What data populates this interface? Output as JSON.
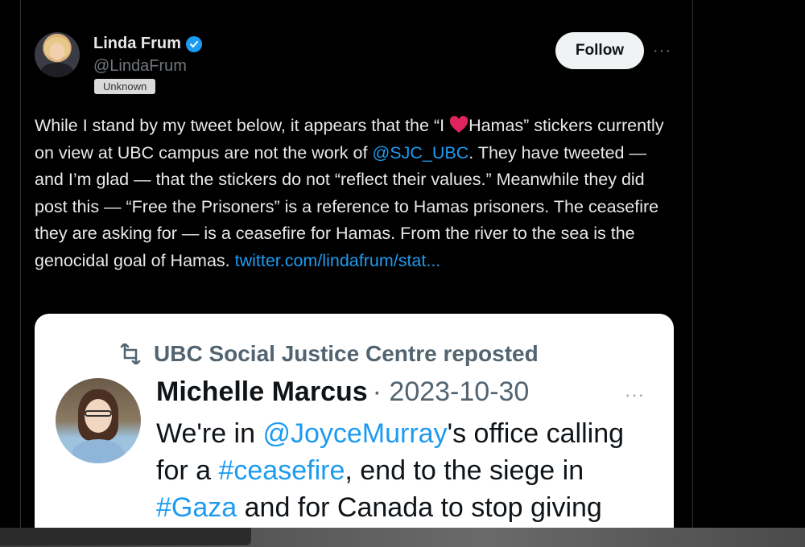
{
  "author": {
    "name": "Linda Frum",
    "handle": "@LindaFrum",
    "badge": "Unknown"
  },
  "follow_label": "Follow",
  "more_icon": "···",
  "tweet": {
    "seg1": "While I stand by my tweet below, it appears that the “I ",
    "seg2": "Hamas” stickers currently on view at UBC campus are not the work of ",
    "mention": "@SJC_UBC",
    "seg3": ". They have tweeted — and I’m glad — that the stickers do not “reflect their values.” Meanwhile they did post this — “Free the Prisoners” is a reference to Hamas prisoners. The ceasefire they are asking for — is a ceasefire for Hamas. From the river to the sea is the genocidal goal of Hamas. ",
    "link": "twitter.com/lindafrum/stat..."
  },
  "quoted": {
    "repost_label": "UBC Social Justice Centre reposted",
    "name": "Michelle Marcus",
    "date": "· 2023-10-30",
    "dots": "···",
    "t1": "We're in ",
    "m1": "@JoyceMurray",
    "t2": "'s office calling for a ",
    "h1": "#ceasefire",
    "t3": ", end to the siege in ",
    "h2": "#Gaza",
    "t4": " and for Canada to stop giving"
  },
  "colors": {
    "background": "#000000",
    "accent": "#1d9bf0",
    "heart": "#f91880"
  },
  "icons": [
    "verified-badge-icon",
    "heart-icon",
    "repost-icon",
    "more-icon"
  ]
}
